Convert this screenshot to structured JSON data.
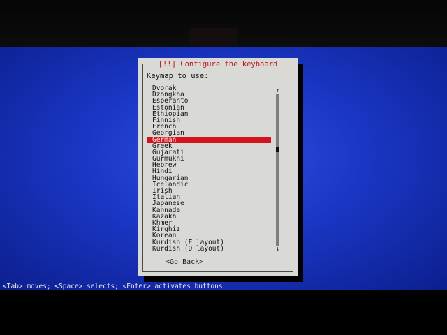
{
  "dialog": {
    "title": "[!!] Configure the keyboard",
    "prompt": "Keymap to use:",
    "keymaps": [
      {
        "label": "Dvorak",
        "selected": false
      },
      {
        "label": "Dzongkha",
        "selected": false
      },
      {
        "label": "Esperanto",
        "selected": false
      },
      {
        "label": "Estonian",
        "selected": false
      },
      {
        "label": "Ethiopian",
        "selected": false
      },
      {
        "label": "Finnish",
        "selected": false
      },
      {
        "label": "French",
        "selected": false
      },
      {
        "label": "Georgian",
        "selected": false
      },
      {
        "label": "German",
        "selected": true
      },
      {
        "label": "Greek",
        "selected": false
      },
      {
        "label": "Gujarati",
        "selected": false
      },
      {
        "label": "Gurmukhi",
        "selected": false
      },
      {
        "label": "Hebrew",
        "selected": false
      },
      {
        "label": "Hindi",
        "selected": false
      },
      {
        "label": "Hungarian",
        "selected": false
      },
      {
        "label": "Icelandic",
        "selected": false
      },
      {
        "label": "Irish",
        "selected": false
      },
      {
        "label": "Italian",
        "selected": false
      },
      {
        "label": "Japanese",
        "selected": false
      },
      {
        "label": "Kannada",
        "selected": false
      },
      {
        "label": "Kazakh",
        "selected": false
      },
      {
        "label": "Khmer",
        "selected": false
      },
      {
        "label": "Kirghiz",
        "selected": false
      },
      {
        "label": "Korean",
        "selected": false
      },
      {
        "label": "Kurdish (F layout)",
        "selected": false
      },
      {
        "label": "Kurdish (Q layout)",
        "selected": false
      }
    ],
    "scroll_up_glyph": "↑",
    "scroll_down_glyph": "↓",
    "back_button_label": "<Go Back>"
  },
  "footer": {
    "hint": "<Tab> moves; <Space> selects; <Enter> activates buttons"
  },
  "colors": {
    "screen_blue": "#1a36c4",
    "dialog_gray": "#d9d9d6",
    "selection_red": "#d3141c",
    "title_red": "#c01818"
  }
}
